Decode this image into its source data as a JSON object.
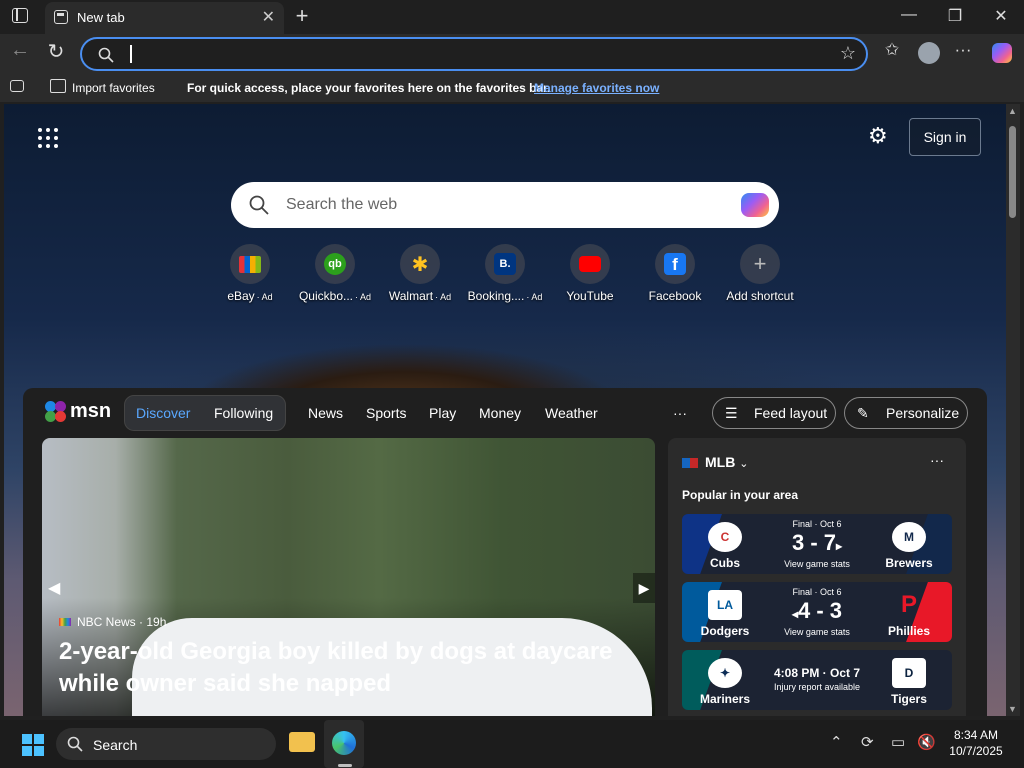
{
  "browser": {
    "tab_title": "New tab",
    "new_tab_symbol": "+",
    "close_symbol": "✕",
    "minimize_symbol": "—",
    "restore_symbol": "❐",
    "address_value": "",
    "accent": "#4a8ef0"
  },
  "favorites_bar": {
    "import_label": "Import favorites",
    "message": "For quick access, place your favorites here on the favorites bar.",
    "manage_link": "Manage favorites now"
  },
  "newtab": {
    "sign_in": "Sign in",
    "search_placeholder": "Search the web",
    "shortcuts": [
      {
        "label": "eBay",
        "ad": "· Ad",
        "icon": "ebay-icon"
      },
      {
        "label": "Quickbo...",
        "ad": "· Ad",
        "icon": "quickbooks-icon"
      },
      {
        "label": "Walmart",
        "ad": "· Ad",
        "icon": "walmart-icon"
      },
      {
        "label": "Booking....",
        "ad": "· Ad",
        "icon": "booking-icon"
      },
      {
        "label": "YouTube",
        "ad": "",
        "icon": "youtube-icon"
      },
      {
        "label": "Facebook",
        "ad": "",
        "icon": "facebook-icon"
      },
      {
        "label": "Add shortcut",
        "ad": "",
        "icon": "plus-icon"
      }
    ]
  },
  "feed": {
    "brand": "msn",
    "tabs": {
      "discover": "Discover",
      "following": "Following"
    },
    "nav": [
      "News",
      "Sports",
      "Play",
      "Money",
      "Weather"
    ],
    "more": "···",
    "feed_layout": "Feed layout",
    "personalize": "Personalize",
    "story": {
      "source": "NBC News",
      "age": "· 19h",
      "headline": "2-year-old Georgia boy killed by dogs at daycare while owner said she napped"
    },
    "sports": {
      "league": "MLB",
      "more": "···",
      "subtitle": "Popular in your area",
      "games": [
        {
          "status": "Final · Oct 6",
          "score": "3 - 7",
          "winner_arrow": "▸",
          "arrow_side": "right",
          "link": "View game stats",
          "home": "Cubs",
          "away": "Brewers",
          "home_color": "#0e3386",
          "away_color": "#12284b"
        },
        {
          "status": "Final · Oct 6",
          "score": "4 - 3",
          "winner_arrow": "◂",
          "arrow_side": "left",
          "link": "View game stats",
          "home": "Dodgers",
          "away": "Phillies",
          "home_color": "#005a9c",
          "away_color": "#e81828"
        },
        {
          "status": "4:08 PM · Oct 7",
          "score": "",
          "winner_arrow": "",
          "arrow_side": "",
          "link": "Injury report available",
          "home": "Mariners",
          "away": "Tigers",
          "home_color": "#005c5c",
          "away_color": "#0c2340"
        }
      ]
    }
  },
  "taskbar": {
    "search_label": "Search",
    "time": "8:34 AM",
    "date": "10/7/2025"
  }
}
